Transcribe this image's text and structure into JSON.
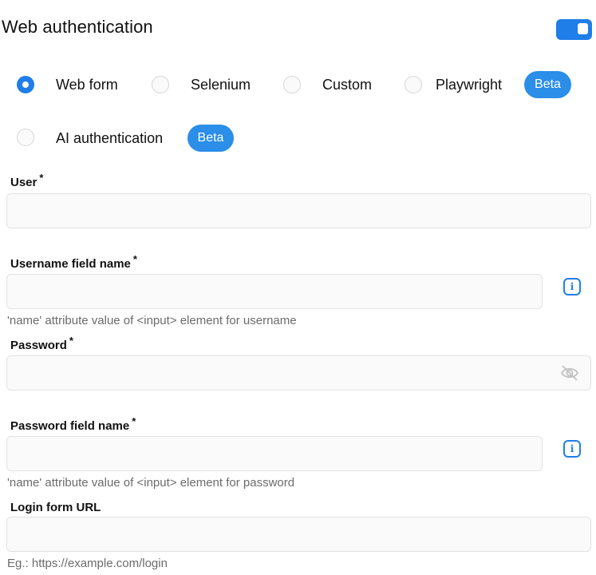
{
  "header": {
    "title": "Web authentication",
    "toggle_enabled": true
  },
  "auth_methods": [
    {
      "label": "Web form",
      "selected": true
    },
    {
      "label": "Selenium",
      "selected": false
    },
    {
      "label": "Custom",
      "selected": false
    },
    {
      "label": "Playwright",
      "selected": false,
      "badge": "Beta"
    },
    {
      "label": "AI authentication",
      "selected": false,
      "badge": "Beta"
    }
  ],
  "fields": {
    "user": {
      "label": "User",
      "required": "*",
      "value": ""
    },
    "username_field": {
      "label": "Username field name",
      "required": "*",
      "value": "",
      "help": "'name' attribute value of <input> element for username"
    },
    "password": {
      "label": "Password",
      "required": "*",
      "value": ""
    },
    "password_field": {
      "label": "Password field name",
      "required": "*",
      "value": "",
      "help": "'name' attribute value of <input> element for password"
    },
    "login_url": {
      "label": "Login form URL",
      "value": "",
      "help": "Eg.: https://example.com/login"
    }
  },
  "icons": {
    "info": "info-icon",
    "eye_off": "eye-off-icon",
    "info_glyph": "i"
  },
  "colors": {
    "accent": "#1f7ee8",
    "badge": "#2b8ee8"
  }
}
